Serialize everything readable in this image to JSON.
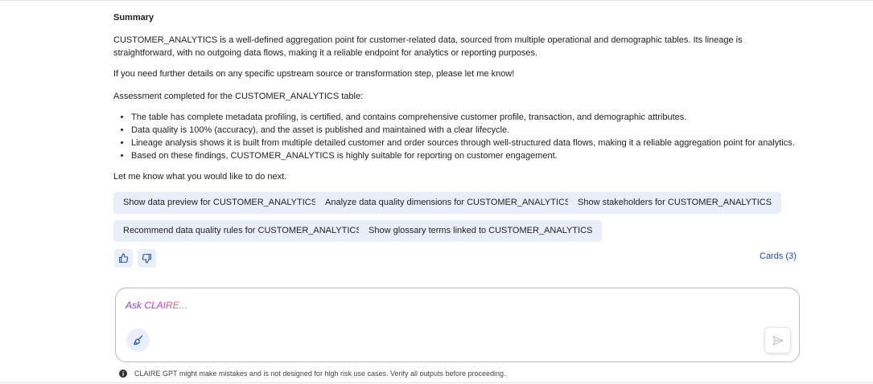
{
  "summary": {
    "heading": "Summary",
    "paragraph1": "CUSTOMER_ANALYTICS is a well-defined aggregation point for customer-related data, sourced from multiple operational and demographic tables. Its lineage is straightforward, with no outgoing data flows, making it a reliable endpoint for analytics or reporting purposes.",
    "paragraph2": "If you need further details on any specific upstream source or transformation step, please let me know!",
    "assessment_intro": "Assessment completed for the CUSTOMER_ANALYTICS table:",
    "bullets": [
      "The table has complete metadata profiling, is certified, and contains comprehensive customer profile, transaction, and demographic attributes.",
      "Data quality is 100% (accuracy), and the asset is published and maintained with a clear lifecycle.",
      "Lineage analysis shows it is built from multiple detailed customer and order sources through well-structured data flows, making it a reliable aggregation point for analytics.",
      "Based on these findings, CUSTOMER_ANALYTICS is highly suitable for reporting on customer engagement."
    ],
    "closing": "Let me know what you would like to do next."
  },
  "suggestions": [
    "Show data preview for CUSTOMER_ANALYTICS",
    "Analyze data quality dimensions for CUSTOMER_ANALYTICS",
    "Show stakeholders for CUSTOMER_ANALYTICS",
    "Recommend data quality rules for CUSTOMER_ANALYTICS",
    "Show glossary terms linked to CUSTOMER_ANALYTICS"
  ],
  "feedback": {
    "thumbs_up_icon": "thumbs-up-icon",
    "thumbs_down_icon": "thumbs-down-icon"
  },
  "cards_link": "Cards (3)",
  "chat_input": {
    "placeholder": "Ask CLAIRE...",
    "brush_icon": "brush-icon",
    "send_icon": "send-icon"
  },
  "disclaimer": "CLAIRE GPT might make mistakes and is not designed for high risk use cases. Verify all outputs before proceeding.",
  "colors": {
    "accent": "#1a4fa3",
    "chip_bg": "#e9eff9",
    "placeholder_gradient": [
      "#6a3df0",
      "#c33bd6",
      "#f08a2d"
    ]
  }
}
